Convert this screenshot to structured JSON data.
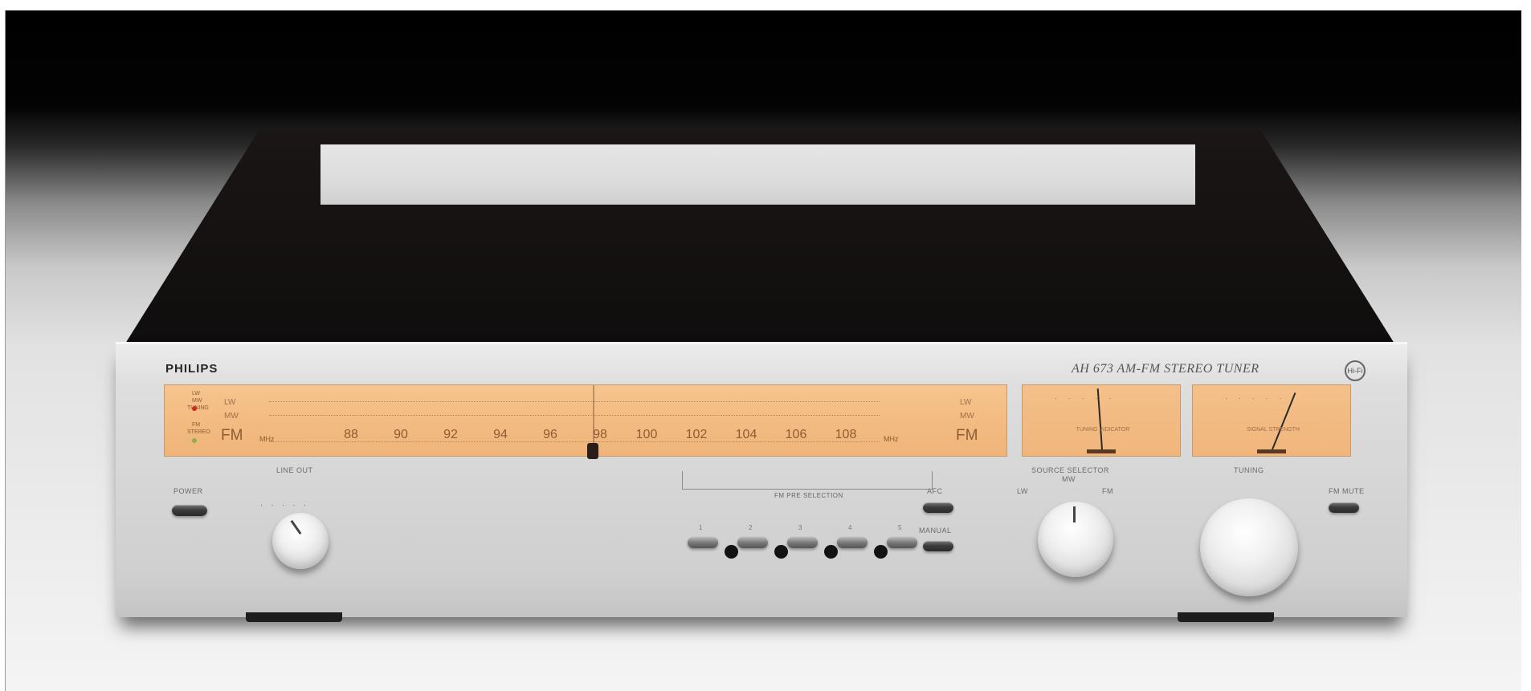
{
  "device": {
    "brand": "PHILIPS",
    "model": "AH 673 AM-FM STEREO TUNER",
    "logo_mark": "Hi-Fi",
    "colors": {
      "dial_backlight": "#f4bd84",
      "faceplate": "#d6d6d6",
      "cover": "#161212"
    }
  },
  "dial": {
    "indicator_labels": [
      "LW",
      "MW",
      "TUNING",
      "FM",
      "STEREO"
    ],
    "band_left": [
      "LW",
      "MW",
      "FM"
    ],
    "band_right": [
      "LW",
      "MW",
      "FM"
    ],
    "unit_left": "MHz",
    "unit_right": "MHz",
    "fm_scale": [
      "88",
      "90",
      "92",
      "94",
      "96",
      "98",
      "100",
      "102",
      "104",
      "106",
      "108"
    ]
  },
  "meters": {
    "tuning": {
      "label": "TUNING INDICATOR"
    },
    "signal": {
      "label": "SIGNAL STRENGTH"
    }
  },
  "controls": {
    "power": "POWER",
    "line_out": "LINE OUT",
    "afc": "AFC",
    "manual": "MANUAL",
    "fm_preset_selection": "FM PRE SELECTION",
    "preset_numbers": [
      "1",
      "2",
      "3",
      "4",
      "5"
    ],
    "source_selector": "SOURCE SELECTOR",
    "source_positions": [
      "LW",
      "MW",
      "FM"
    ],
    "tuning": "TUNING",
    "fm_mute": "FM MUTE"
  }
}
